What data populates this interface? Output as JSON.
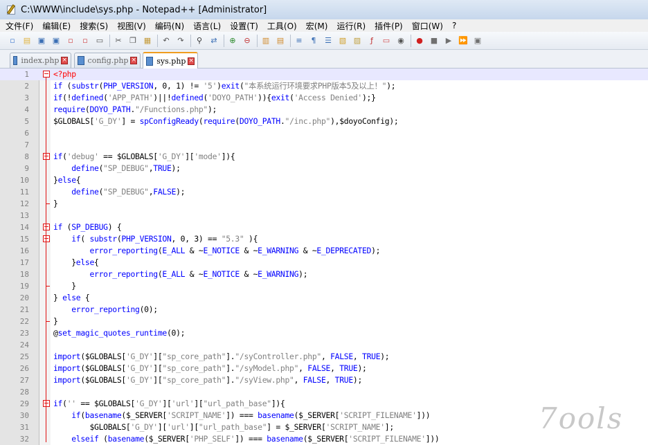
{
  "window": {
    "title": "C:\\WWW\\include\\sys.php - Notepad++ [Administrator]"
  },
  "menu": [
    "文件(F)",
    "编辑(E)",
    "搜索(S)",
    "视图(V)",
    "编码(N)",
    "语言(L)",
    "设置(T)",
    "工具(O)",
    "宏(M)",
    "运行(R)",
    "插件(P)",
    "窗口(W)",
    "?"
  ],
  "toolbar": {
    "buttons": [
      {
        "name": "new-file-icon",
        "glyph": "▫",
        "color": "#4a7fd0"
      },
      {
        "name": "open-file-icon",
        "glyph": "▤",
        "color": "#e2b33c"
      },
      {
        "name": "save-icon",
        "glyph": "▣",
        "color": "#3b6fb5"
      },
      {
        "name": "save-all-icon",
        "glyph": "▣",
        "color": "#3b6fb5"
      },
      {
        "name": "close-icon",
        "glyph": "▫",
        "color": "#d04a4a"
      },
      {
        "name": "close-all-icon",
        "glyph": "▫",
        "color": "#d04a4a"
      },
      {
        "name": "print-icon",
        "glyph": "▭",
        "color": "#555555"
      },
      {
        "sep": true
      },
      {
        "name": "cut-icon",
        "glyph": "✂",
        "color": "#555555"
      },
      {
        "name": "copy-icon",
        "glyph": "❐",
        "color": "#555555"
      },
      {
        "name": "paste-icon",
        "glyph": "▦",
        "color": "#c49a38"
      },
      {
        "sep": true
      },
      {
        "name": "undo-icon",
        "glyph": "↶",
        "color": "#555555"
      },
      {
        "name": "redo-icon",
        "glyph": "↷",
        "color": "#555555"
      },
      {
        "sep": true
      },
      {
        "name": "find-icon",
        "glyph": "⚲",
        "color": "#333333"
      },
      {
        "name": "replace-icon",
        "glyph": "⇄",
        "color": "#3b6fb5"
      },
      {
        "sep": true
      },
      {
        "name": "zoom-in-icon",
        "glyph": "⊕",
        "color": "#2c8a2c"
      },
      {
        "name": "zoom-out-icon",
        "glyph": "⊖",
        "color": "#c03030"
      },
      {
        "sep": true
      },
      {
        "name": "sync-vertical-icon",
        "glyph": "▥",
        "color": "#d08a2c"
      },
      {
        "name": "sync-horizontal-icon",
        "glyph": "▤",
        "color": "#d08a2c"
      },
      {
        "sep": true
      },
      {
        "name": "word-wrap-icon",
        "glyph": "≡",
        "color": "#3b6fb5"
      },
      {
        "name": "show-all-chars-icon",
        "glyph": "¶",
        "color": "#3b6fb5"
      },
      {
        "name": "indent-guide-icon",
        "glyph": "☰",
        "color": "#3b6fb5"
      },
      {
        "name": "user-language-icon",
        "glyph": "▧",
        "color": "#d0a02c"
      },
      {
        "name": "doc-map-icon",
        "glyph": "▨",
        "color": "#c0a040"
      },
      {
        "name": "function-list-icon",
        "glyph": "ƒ",
        "color": "#c03030"
      },
      {
        "name": "folder-workspace-icon",
        "glyph": "▭",
        "color": "#d04a4a"
      },
      {
        "name": "monitor-icon",
        "glyph": "◉",
        "color": "#555555"
      },
      {
        "sep": true
      },
      {
        "name": "record-macro-icon",
        "glyph": "●",
        "color": "#d02020"
      },
      {
        "name": "stop-macro-icon",
        "glyph": "■",
        "color": "#707070"
      },
      {
        "name": "play-macro-icon",
        "glyph": "▶",
        "color": "#707070"
      },
      {
        "name": "run-macro-multiple-icon",
        "glyph": "⏩",
        "color": "#3b6fb5"
      },
      {
        "name": "save-macro-icon",
        "glyph": "▣",
        "color": "#707070"
      }
    ]
  },
  "tabs": [
    {
      "label": "index.php",
      "active": false
    },
    {
      "label": "config.php",
      "active": false
    },
    {
      "label": "sys.php",
      "active": true
    }
  ],
  "editor": {
    "lines": [
      {
        "n": "1",
        "text": "<?php",
        "color": "#ff0000"
      },
      {
        "n": "2",
        "text": "if (substr(PHP_VERSION, 0, 1) != '5')exit(\"本系统运行环境要求PHP版本5及以上！\");"
      },
      {
        "n": "3",
        "text": "if(!defined('APP_PATH')||!defined('DOYO_PATH')){exit('Access Denied');}"
      },
      {
        "n": "4",
        "text": "require(DOYO_PATH.\"/Functions.php\");"
      },
      {
        "n": "5",
        "text": "$GLOBALS['G_DY'] = spConfigReady(require(DOYO_PATH.\"/inc.php\"),$doyoConfig);"
      },
      {
        "n": "6",
        "text": ""
      },
      {
        "n": "7",
        "text": ""
      },
      {
        "n": "8",
        "text": "if('debug' == $GLOBALS['G_DY']['mode']){"
      },
      {
        "n": "9",
        "text": "    define(\"SP_DEBUG\",TRUE);"
      },
      {
        "n": "10",
        "text": "}else{"
      },
      {
        "n": "11",
        "text": "    define(\"SP_DEBUG\",FALSE);"
      },
      {
        "n": "12",
        "text": "}"
      },
      {
        "n": "13",
        "text": ""
      },
      {
        "n": "14",
        "text": "if (SP_DEBUG) {"
      },
      {
        "n": "15",
        "text": "    if( substr(PHP_VERSION, 0, 3) == \"5.3\" ){"
      },
      {
        "n": "16",
        "text": "        error_reporting(E_ALL & ~E_NOTICE & ~E_WARNING & ~E_DEPRECATED);"
      },
      {
        "n": "17",
        "text": "    }else{"
      },
      {
        "n": "18",
        "text": "        error_reporting(E_ALL & ~E_NOTICE & ~E_WARNING);"
      },
      {
        "n": "19",
        "text": "    }"
      },
      {
        "n": "20",
        "text": "} else {"
      },
      {
        "n": "21",
        "text": "    error_reporting(0);"
      },
      {
        "n": "22",
        "text": "}"
      },
      {
        "n": "23",
        "text": "@set_magic_quotes_runtime(0);"
      },
      {
        "n": "24",
        "text": ""
      },
      {
        "n": "25",
        "text": "import($GLOBALS['G_DY'][\"sp_core_path\"].\"/syController.php\", FALSE, TRUE);"
      },
      {
        "n": "26",
        "text": "import($GLOBALS['G_DY'][\"sp_core_path\"].\"/syModel.php\", FALSE, TRUE);"
      },
      {
        "n": "27",
        "text": "import($GLOBALS['G_DY'][\"sp_core_path\"].\"/syView.php\", FALSE, TRUE);"
      },
      {
        "n": "28",
        "text": ""
      },
      {
        "n": "29",
        "text": "if('' == $GLOBALS['G_DY']['url'][\"url_path_base\"]){"
      },
      {
        "n": "30",
        "text": "    if(basename($_SERVER['SCRIPT_NAME']) === basename($_SERVER['SCRIPT_FILENAME']))"
      },
      {
        "n": "31",
        "text": "        $GLOBALS['G_DY']['url'][\"url_path_base\"] = $_SERVER['SCRIPT_NAME'];"
      },
      {
        "n": "32",
        "text": "    elseif (basename($_SERVER['PHP_SELF']) === basename($_SERVER['SCRIPT_FILENAME']))"
      }
    ]
  },
  "watermark": {
    "text": "7ools"
  },
  "colors": {
    "keyword": "#0000ff",
    "string": "#808080",
    "operator": "#000080",
    "phptag": "#ff0000",
    "fold_marker": "#e01010",
    "current_line": "#e8e8ff"
  }
}
